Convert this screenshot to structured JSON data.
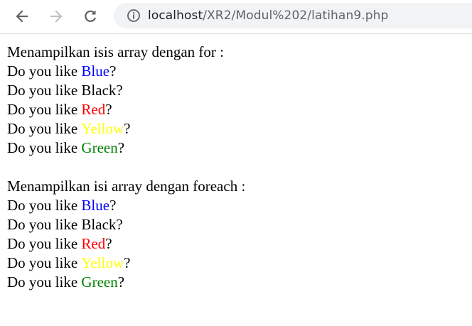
{
  "browser": {
    "url_host": "localhost",
    "url_path": "/XR2/Modul%202/latihan9.php"
  },
  "page": {
    "section1": {
      "heading": "Menampilkan isis array dengan for :",
      "items": [
        {
          "prefix": "Do you like ",
          "color_name": "Blue",
          "color": "#0000ff",
          "suffix": "?"
        },
        {
          "prefix": "Do you like ",
          "color_name": "Black",
          "color": "#000000",
          "suffix": "?"
        },
        {
          "prefix": "Do you like ",
          "color_name": "Red",
          "color": "#ff0000",
          "suffix": "?"
        },
        {
          "prefix": "Do you like ",
          "color_name": "Yellow",
          "color": "#ffff00",
          "suffix": "?"
        },
        {
          "prefix": "Do you like ",
          "color_name": "Green",
          "color": "#008000",
          "suffix": "?"
        }
      ]
    },
    "section2": {
      "heading": "Menampilkan isi array dengan foreach :",
      "items": [
        {
          "prefix": "Do you like ",
          "color_name": "Blue",
          "color": "#0000ff",
          "suffix": "?"
        },
        {
          "prefix": "Do you like ",
          "color_name": "Black",
          "color": "#000000",
          "suffix": "?"
        },
        {
          "prefix": "Do you like ",
          "color_name": "Red",
          "color": "#ff0000",
          "suffix": "?"
        },
        {
          "prefix": "Do you like ",
          "color_name": "Yellow",
          "color": "#ffff00",
          "suffix": "?"
        },
        {
          "prefix": "Do you like ",
          "color_name": "Green",
          "color": "#008000",
          "suffix": "?"
        }
      ]
    }
  },
  "icons": {
    "back": "arrow-left-icon",
    "forward": "arrow-right-icon",
    "reload": "reload-icon",
    "info": "info-icon"
  }
}
